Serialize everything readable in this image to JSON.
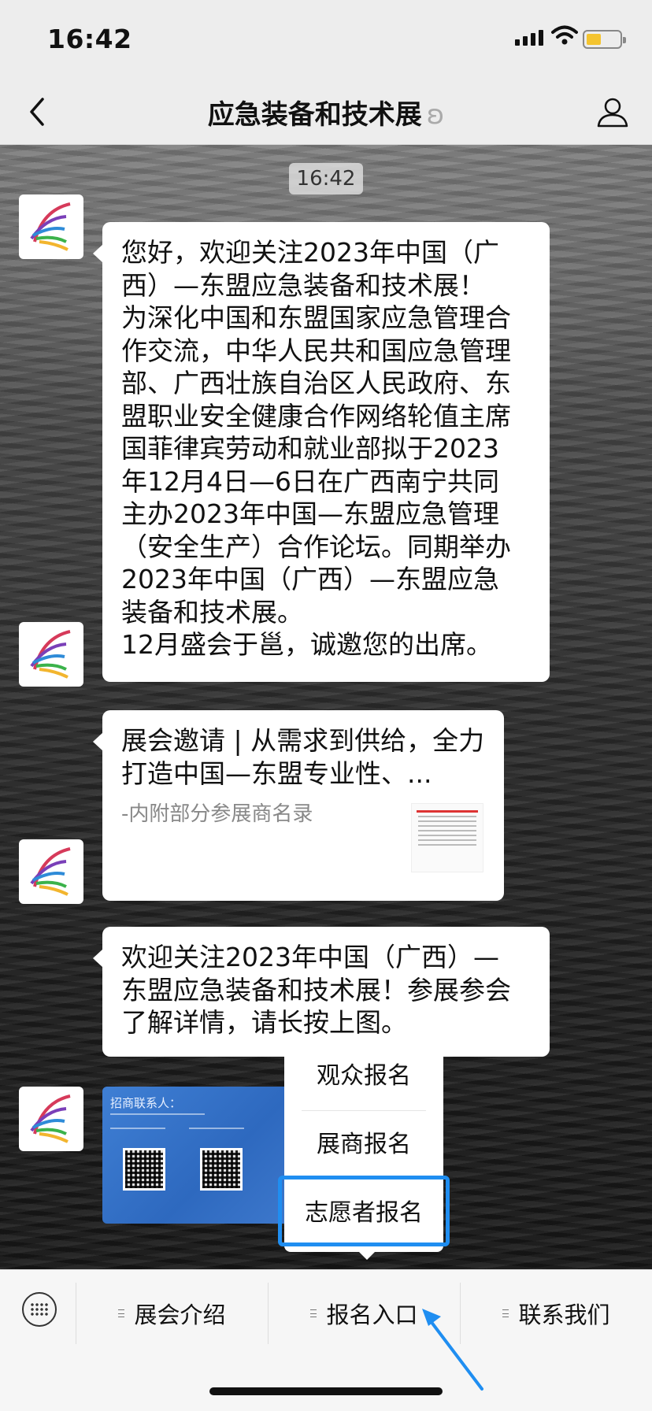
{
  "status": {
    "time": "16:42"
  },
  "header": {
    "title": "应急装备和技术展",
    "earpiece": "ʚ"
  },
  "chat": {
    "timestamp": "16:42",
    "messages": [
      {
        "lines": [
          "您好，欢迎关注2023年中国（广",
          "西）—东盟应急装备和技术展！",
          "为深化中国和东盟国家应急管理合",
          "作交流，中华人民共和国应急管理",
          "部、广西壮族自治区人民政府、东",
          "盟职业安全健康合作网络轮值主席",
          "国菲律宾劳动和就业部拟于2023",
          "年12月4日—6日在广西南宁共同",
          "主办2023年中国—东盟应急管理",
          "（安全生产）合作论坛。同期举办",
          "2023年中国（广西）—东盟应急",
          "装备和技术展。",
          "12月盛会于邕，诚邀您的出席。"
        ]
      },
      {
        "card_title": "展会邀请 | 从需求到供给，全力打造中国—东盟专业性、...",
        "card_desc": "-内附部分参展商名录"
      },
      {
        "lines": [
          "欢迎关注2023年中国（广西）—",
          "东盟应急装备和技术展！参展参会",
          "了解详情，请长按上图。"
        ]
      },
      {
        "image_header": "招商联系人："
      }
    ]
  },
  "popup": {
    "items": [
      "观众报名",
      "展商报名",
      "志愿者报名"
    ],
    "highlighted": "志愿者报名"
  },
  "bottom_menu": {
    "items": [
      "展会介绍",
      "报名入口",
      "联系我们"
    ]
  },
  "colors": {
    "highlight": "#1f8ef1",
    "bar_bg": "#ededed"
  }
}
